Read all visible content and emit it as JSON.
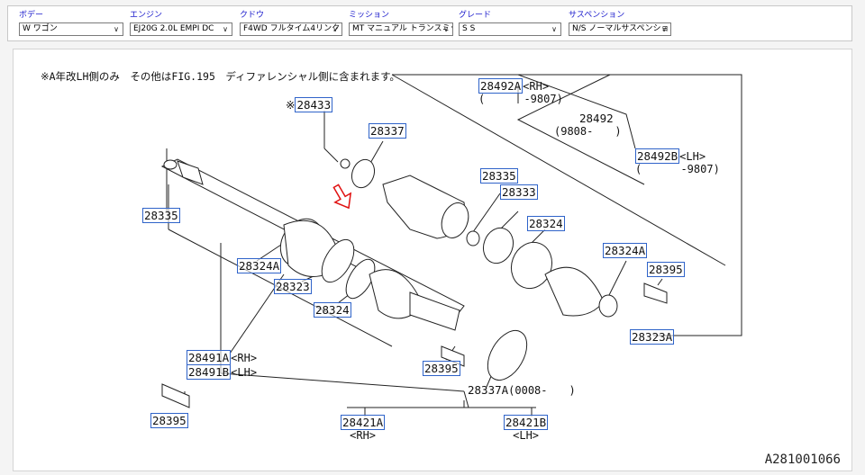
{
  "filters": [
    {
      "label": "ボデー",
      "value": "W ワゴン"
    },
    {
      "label": "エンジン",
      "value": "EJ20G 2.0L EMPI DC"
    },
    {
      "label": "クドウ",
      "value": "F4WD フルタイム4リンクド"
    },
    {
      "label": "ミッション",
      "value": "MT マニュアル トランスミッシ"
    },
    {
      "label": "グレード",
      "value": "S S"
    },
    {
      "label": "サスペンション",
      "value": "N/S ノーマルサスペンション"
    }
  ],
  "diagram": {
    "note": "※A年改LH側のみ　その他はFIG.195　ディファレンシャル側に含まれます。",
    "code": "A281001066",
    "colors": {
      "link": "#2f63c9",
      "arrow": "#e01010",
      "line": "#222222"
    },
    "parts": {
      "p28433": {
        "prefix": "※",
        "num": "28433"
      },
      "p28337": {
        "num": "28337"
      },
      "p28492A": {
        "num": "28492A",
        "suffix": "<RH>",
        "sub": "(　　　 -9807)"
      },
      "p28492": {
        "num": "28492",
        "sub": "(9808-　　)"
      },
      "p28492B": {
        "num": "28492B",
        "suffix": "<LH>",
        "sub": "(　　　 -9807)"
      },
      "p28335_top": {
        "num": "28335"
      },
      "p28333": {
        "num": "28333"
      },
      "p28324_top": {
        "num": "28324"
      },
      "p28324A_right": {
        "num": "28324A"
      },
      "p28395_right": {
        "num": "28395"
      },
      "p28335_left": {
        "num": "28335"
      },
      "p28324A_left": {
        "num": "28324A"
      },
      "p28323": {
        "num": "28323"
      },
      "p28324_mid": {
        "num": "28324"
      },
      "p28323A": {
        "num": "28323A"
      },
      "p28491A": {
        "num": "28491A",
        "suffix": "<RH>"
      },
      "p28491B": {
        "num": "28491B",
        "suffix": "<LH>"
      },
      "p28395_mid": {
        "num": "28395"
      },
      "p28337A": {
        "num": "28337A",
        "suffix": "(0008-　　)"
      },
      "p28395_bottom": {
        "num": "28395"
      },
      "p28421A": {
        "num": "28421A",
        "sub": "<RH>"
      },
      "p28421B": {
        "num": "28421B",
        "sub": "<LH>"
      }
    }
  }
}
